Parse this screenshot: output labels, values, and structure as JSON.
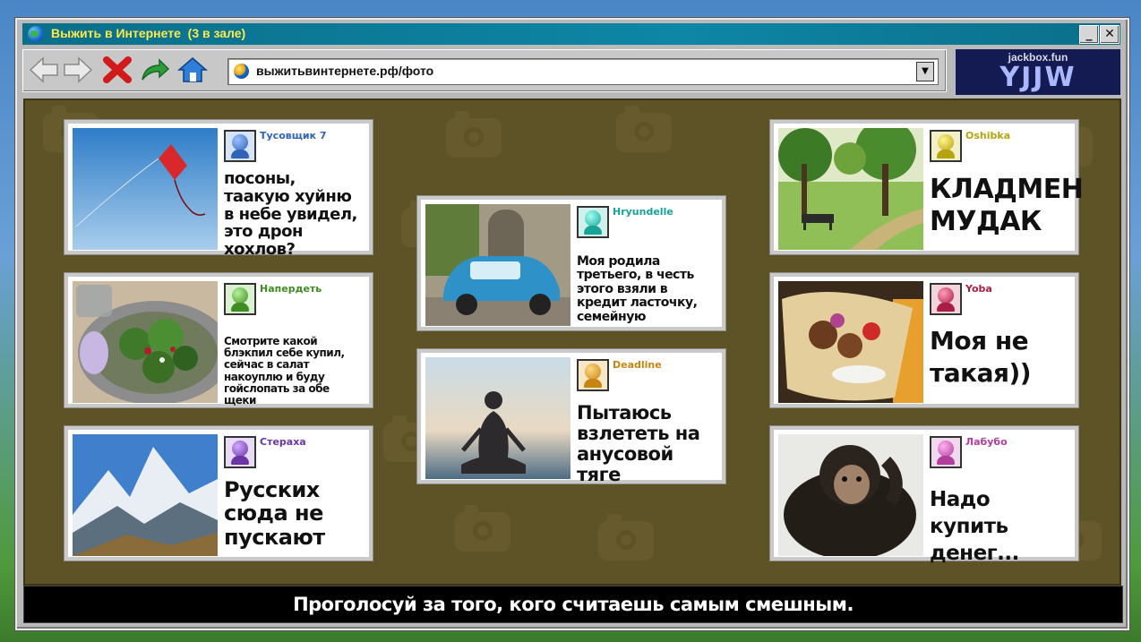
{
  "window": {
    "title": "Выжить в Интернете",
    "audience": "(3 в зале)",
    "minimize": "_",
    "close": "✕"
  },
  "toolbar": {
    "url": "выжитьвинтернете.рф/фото",
    "dropdown": "▼"
  },
  "logo": {
    "site": "jackbox.fun",
    "code": "YJJW"
  },
  "posts": [
    {
      "user": "Тусовщик 7",
      "color": "#2f64b8",
      "text": "посоны, таакую хуйню в небе увидел, это дрон хохлов?",
      "image": "kite-in-sky"
    },
    {
      "user": "Напердеть",
      "color": "#3f8d22",
      "text": "Смотрите какой блэкпил себе купил, сейчас в салат накоуплю и буду гойслопать за обе щеки",
      "image": "salad"
    },
    {
      "user": "Стераха",
      "color": "#6b35a8",
      "text": "Русских сюда не пускают",
      "image": "mountains"
    },
    {
      "user": "Hryundelle",
      "color": "#18a399",
      "text": "Моя родила третьего, в честь этого взяли в кредит ласточку, семейную",
      "image": "blue-car"
    },
    {
      "user": "Deadline",
      "color": "#c88410",
      "text": "Пытаюсь взлететь на анусовой тяге",
      "image": "meditation"
    },
    {
      "user": "Oshibka",
      "color": "#b6a30f",
      "text": "КЛАДМЕН МУДАК",
      "image": "park"
    },
    {
      "user": "Yoba",
      "color": "#a81e45",
      "text": "Моя не такая))",
      "image": "kebab"
    },
    {
      "user": "Лабубо",
      "color": "#b13e9c",
      "text": "Надо купить денег...",
      "image": "chimp"
    }
  ],
  "prompt": "Проголосуй за того, кого считаешь самым смешным."
}
